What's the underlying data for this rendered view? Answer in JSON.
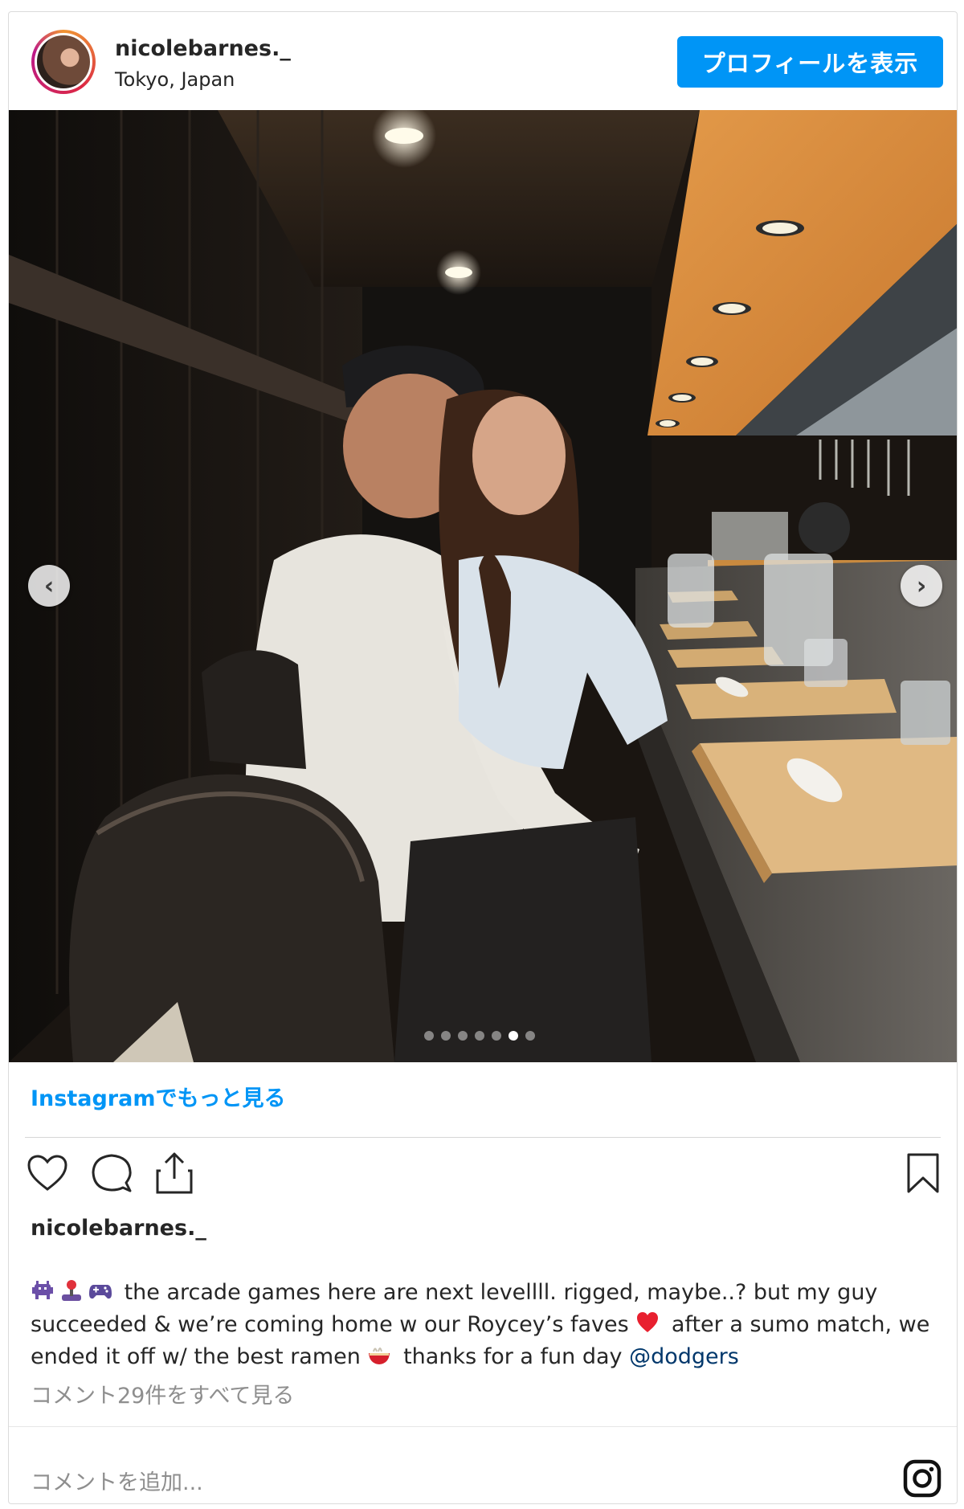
{
  "post": {
    "username": "nicolebarnes._",
    "location": "Tokyo, Japan",
    "profile_button": "プロフィールを表示",
    "more_link": "Instagramでもっと見る",
    "caption_user": "nicolebarnes._",
    "caption_part1": "the arcade games here are next levellll. rigged, maybe..? but my guy succeeded & we’re coming home w our Roycey’s faves",
    "caption_part2": "after a sumo match, we ended it off w/ the best ramen",
    "caption_part3": "thanks for a fun day",
    "mention": "@dodgers",
    "view_comments": "コメント29件をすべて見る",
    "comment_placeholder": "コメントを追加..."
  },
  "carousel": {
    "total_slides": 7,
    "active_slide": 6
  },
  "icons": {
    "prev": "chevron-left-icon",
    "next": "chevron-right-icon",
    "like": "heart-icon",
    "comment": "comment-icon",
    "share": "share-icon",
    "save": "bookmark-icon",
    "logo": "instagram-logo-icon",
    "emojis": [
      "alien-monster-icon",
      "joystick-icon",
      "game-controller-icon",
      "red-heart-icon",
      "noodle-bowl-icon"
    ]
  },
  "colors": {
    "accent": "#0095f6",
    "text": "#262626",
    "muted": "#8e8e8e",
    "mention": "#00376b"
  }
}
